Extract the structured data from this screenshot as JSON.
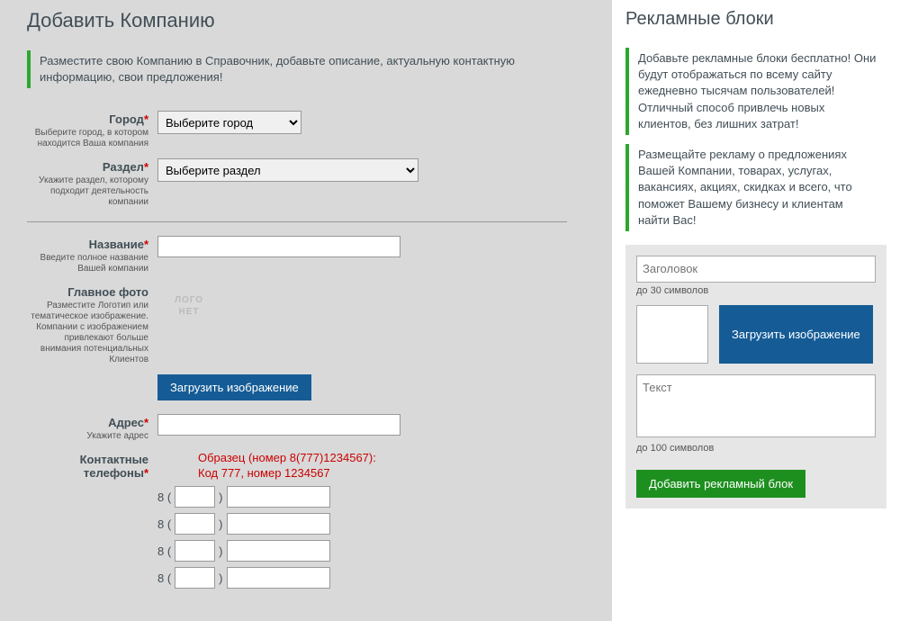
{
  "main": {
    "title": "Добавить Компанию",
    "intro": "Разместите свою Компанию в Справочник, добавьте описание, актуальную контактную информацию, свои предложения!",
    "city": {
      "label": "Город",
      "help": "Выберите город, в котором находится Ваша компания",
      "placeholder": "Выберите город"
    },
    "section": {
      "label": "Раздел",
      "help": "Укажите раздел, которому подходит деятельность компании",
      "placeholder": "Выберите раздел"
    },
    "name": {
      "label": "Название",
      "help": "Введите полное название Вашей компании"
    },
    "photo": {
      "label": "Главное фото",
      "help": "Разместите Логотип или тематическое изображение. Компании с изображением привлекают больше внимания потенциальных Клиентов",
      "placeholder_line1": "ЛОГО",
      "placeholder_line2": "НЕТ",
      "upload_button": "Загрузить изображение"
    },
    "address": {
      "label": "Адрес",
      "help": "Укажите адрес"
    },
    "phones": {
      "label": "Контактные телефоны",
      "sample_line1": "Образец (номер 8(777)1234567):",
      "sample_line2": "Код 777, номер 1234567",
      "prefix": "8 (",
      "suffix": ")"
    }
  },
  "sidebar": {
    "title": "Рекламные блоки",
    "intro1": "Добавьте рекламные блоки бесплатно! Они будут отображаться по всему сайту ежедневно тысячам пользователей!\nОтличный способ привлечь новых клиентов, без лишних затрат!",
    "intro2": "Размещайте рекламу о предложениях Вашей Компании, товарах, услугах, вакансиях, акциях, скидках и всего, что поможет Вашему бизнесу и клиентам найти Вас!",
    "ad_title_placeholder": "Заголовок",
    "ad_title_limit": "до 30 символов",
    "upload_button": "Загрузить изображение",
    "ad_text_placeholder": "Текст",
    "ad_text_limit": "до 100 символов",
    "add_button": "Добавить рекламный блок"
  }
}
